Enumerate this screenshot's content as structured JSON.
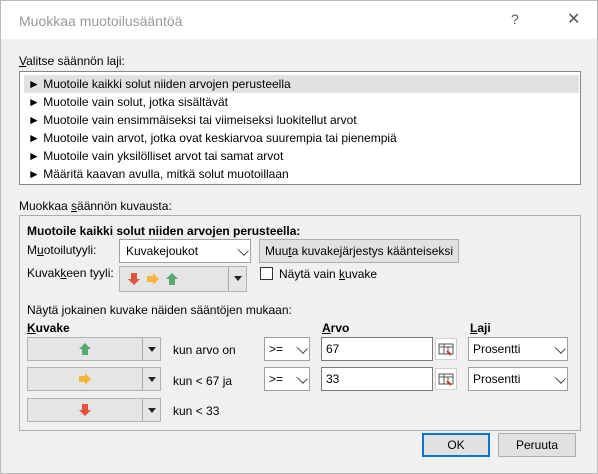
{
  "window": {
    "title": "Muokkaa muotoilusääntöä",
    "help_glyph": "?",
    "close_glyph": "✕"
  },
  "rule_type": {
    "heading_underlined": "V",
    "heading_rest": "alitse säännön laji:",
    "items": [
      {
        "label": "► Muotoile kaikki solut niiden arvojen perusteella",
        "selected": true
      },
      {
        "label": "► Muotoile vain solut, jotka sisältävät",
        "selected": false
      },
      {
        "label": "► Muotoile vain ensimmäiseksi tai viimeiseksi luokitellut arvot",
        "selected": false
      },
      {
        "label": "► Muotoile vain arvot, jotka ovat keskiarvoa suurempia tai pienempiä",
        "selected": false
      },
      {
        "label": "► Muotoile vain yksilölliset arvot tai samat arvot",
        "selected": false
      },
      {
        "label": "► Määritä kaavan avulla, mitkä solut muotoillaan",
        "selected": false
      }
    ]
  },
  "description": {
    "heading_a": "Muokkaa ",
    "heading_underlined": "s",
    "heading_b": "äännön kuvausta:",
    "bold_title": "Muotoile kaikki solut niiden arvojen perusteella:",
    "format_style": {
      "label_a": "M",
      "label_underlined": "u",
      "label_b": "otoilutyyli:",
      "value": "Kuvakejoukot"
    },
    "reverse_button": {
      "label_a": "Muu",
      "label_underlined": "t",
      "label_b": "a kuvakejärjestys käänteiseksi"
    },
    "icon_style": {
      "label_a": "Kuvak",
      "label_underlined": "k",
      "label_b": "een tyyli:"
    },
    "show_icon_only": {
      "label_a": "Näytä vain ",
      "label_underlined": "k",
      "label_b": "uvake",
      "checked": false
    },
    "display_rule_text": "Näytä jokainen kuvake näiden sääntöjen mukaan:",
    "col_icon_underlined": "K",
    "col_icon_rest": "uvake",
    "col_value_underlined": "A",
    "col_value_rest": "rvo",
    "col_type_underlined": "L",
    "col_type_rest": "aji",
    "rows": [
      {
        "icon": "up-arrow-icon",
        "condition": "kun arvo on",
        "operator": ">=",
        "value": "67",
        "type": "Prosentti"
      },
      {
        "icon": "right-arrow-icon",
        "condition": "kun < 67 ja",
        "operator": ">=",
        "value": "33",
        "type": "Prosentti"
      },
      {
        "icon": "down-arrow-icon",
        "condition": "kun < 33"
      }
    ]
  },
  "colors": {
    "green": "#59a86f",
    "yellow": "#f4b63a",
    "red": "#e0533c"
  },
  "buttons": {
    "ok": "OK",
    "cancel": "Peruuta"
  }
}
